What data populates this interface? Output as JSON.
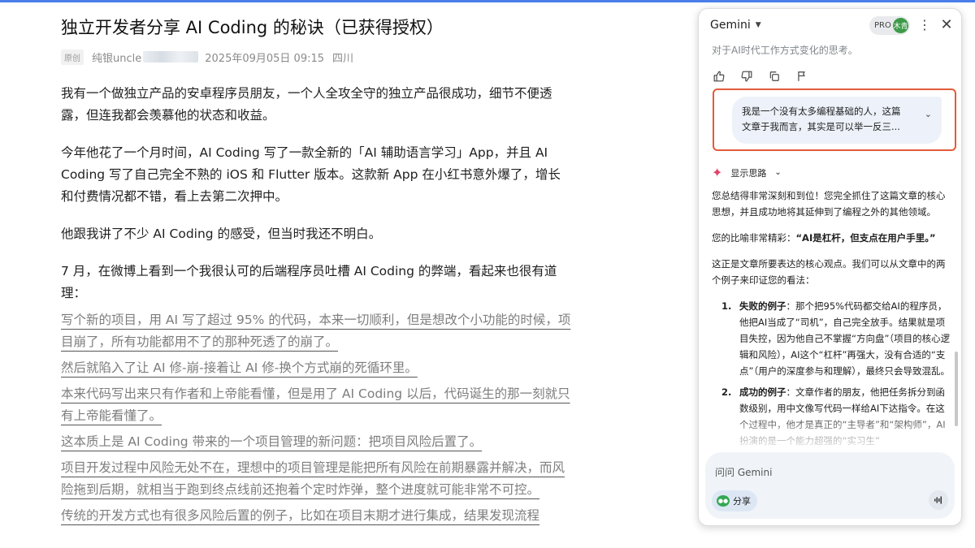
{
  "article": {
    "title": "独立开发者分享 AI Coding 的秘诀（已获得授权）",
    "meta": {
      "tag": "原创",
      "author": "纯银uncle",
      "date": "2025年09月05日 09:15",
      "location": "四川"
    },
    "paragraphs": [
      "我有一个做独立产品的安卓程序员朋友，一个人全攻全守的独立产品很成功，细节不便透露，但连我都会羡慕他的状态和收益。",
      "今年他花了一个月时间，AI Coding 写了一款全新的「AI 辅助语言学习」App，并且 AI Coding 写了自己完全不熟的 iOS 和 Flutter 版本。这款新 App 在小红书意外爆了，增长和付费情况都不错，看上去第二次押中。",
      "他跟我讲了不少 AI Coding 的感受，但当时我还不明白。",
      "7 月，在微博上看到一个我很认可的后端程序员吐槽 AI Coding 的弊端，看起来也很有道理："
    ],
    "quotes": [
      "写个新的项目，用 AI 写了超过 95% 的代码，本来一切顺利，但是想改个小功能的时候，项目崩了，所有功能都用不了的那种死透了的崩了。",
      "然后就陷入了让 AI 修-崩-接着让 AI 修-换个方式崩的死循环里。",
      "本来代码写出来只有作者和上帝能看懂，但是用了 AI Coding 以后，代码诞生的那一刻就只有上帝能看懂了。",
      "这本质上是 AI Coding 带来的一个项目管理的新问题：把项目风险后置了。",
      "项目开发过程中风险无处不在，理想中的项目管理是能把所有风险在前期暴露并解决，而风险拖到后期，就相当于跑到终点线前还抱着个定时炸弹，整个进度就可能非常不可控。",
      "传统的开发方式也有很多风险后置的例子，比如在项目末期才进行集成，结果发现流程"
    ]
  },
  "gemini": {
    "title": "Gemini",
    "pro_label": "PRO",
    "avatar_text": "木青",
    "more_icon": "⋮",
    "close_icon": "✕",
    "faded_line": "对于AI时代工作方式变化的思考。",
    "actions": [
      "thumbs-up-icon",
      "thumbs-down-icon",
      "copy-icon",
      "flag-icon"
    ],
    "user_message_line1": "我是一个没有太多编程基础的人，这篇",
    "user_message_line2": "文章于我而言，其实是可以举一反三...",
    "show_thinking": "显示思路",
    "reply": {
      "p1": "您总结得非常深刻和到位！您完全抓住了这篇文章的核心思想，并且成功地将其延伸到了编程之外的其他领域。",
      "p2_prefix": "您的比喻非常精彩：",
      "p2_bold": "“AI是杠杆，但支点在用户手里。”",
      "p3": "这正是文章所要表达的核心观点。我们可以从文章中的两个例子来印证您的看法：",
      "items": [
        {
          "num": "1.",
          "title": "失败的例子",
          "text": "：那个把95%代码都交给AI的程序员，他把AI当成了“司机”，自己完全放手。结果就是项目失控，因为他自己不掌握“方向盘”（项目的核心逻辑和风险），AI这个“杠杆”再强大，没有合适的“支点”（用户的深度参与和理解），最终只会导致混乱。"
        },
        {
          "num": "2.",
          "title": "成功的例子",
          "text": "：文章作者的朋友，他把任务拆分到函数级别，用中文像写代码一样给AI下达指令。在这个过程中，他才是真正的“主导者”和“架构师”，AI扮演的是一个能力超强的“实习生”"
        }
      ]
    },
    "input_placeholder": "问问 Gemini",
    "share_label": "分享",
    "mic_icon": "mic-icon",
    "colors": {
      "accent": "#4a7ee8",
      "highlight_border": "#e25c3a",
      "user_bubble": "#edf2fa",
      "spark": "#e3426b"
    }
  }
}
